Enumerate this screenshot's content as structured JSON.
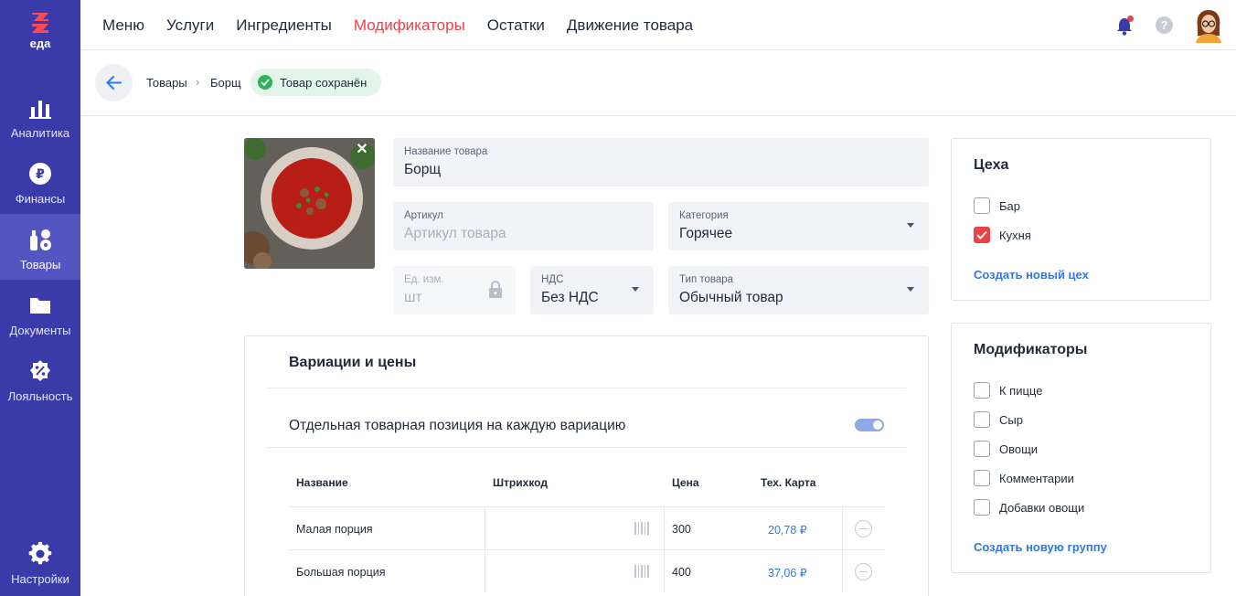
{
  "app": {
    "logo_text": "еда"
  },
  "sidebar": {
    "items": [
      {
        "label": "Аналитика",
        "icon": "chart-bars-icon"
      },
      {
        "label": "Финансы",
        "icon": "ruble-icon"
      },
      {
        "label": "Товары",
        "icon": "products-icon",
        "active": true
      },
      {
        "label": "Документы",
        "icon": "folder-icon"
      },
      {
        "label": "Лояльность",
        "icon": "discount-badge-icon"
      }
    ],
    "settings": {
      "label": "Настройки",
      "icon": "gear-icon"
    }
  },
  "topnav": {
    "items": [
      "Меню",
      "Услуги",
      "Ингредиенты",
      "Модификаторы",
      "Остатки",
      "Движение товара"
    ],
    "active": "Модификаторы"
  },
  "breadcrumb": {
    "items": [
      "Товары",
      "Борщ"
    ],
    "separator": "›",
    "saved_status": "Товар сохранён"
  },
  "product": {
    "name": {
      "label": "Название товара",
      "value": "Борщ"
    },
    "sku": {
      "label": "Артикул",
      "placeholder": "Артикул товара"
    },
    "category": {
      "label": "Категория",
      "value": "Горячее"
    },
    "unit": {
      "label": "Ед. изм.",
      "value": "шт"
    },
    "vat": {
      "label": "НДС",
      "value": "Без НДС"
    },
    "type": {
      "label": "Тип товара",
      "value": "Обычный товар"
    }
  },
  "variations": {
    "title": "Вариации и цены",
    "toggle_label": "Отдельная товарная позиция на каждую вариацию",
    "toggle_on": true,
    "columns": [
      "Название",
      "Штрихкод",
      "Цена",
      "Тех. Карта"
    ],
    "rows": [
      {
        "name": "Малая порция",
        "barcode": "",
        "price": "300",
        "tech_card": "20,78 ₽"
      },
      {
        "name": "Большая порция",
        "barcode": "",
        "price": "400",
        "tech_card": "37,06 ₽"
      }
    ]
  },
  "workshops": {
    "title": "Цеха",
    "items": [
      {
        "label": "Бар",
        "checked": false
      },
      {
        "label": "Кухня",
        "checked": true
      }
    ],
    "create_link": "Создать новый цех"
  },
  "modifiers": {
    "title": "Модификаторы",
    "items": [
      {
        "label": "К пицце",
        "checked": false
      },
      {
        "label": "Сыр",
        "checked": false
      },
      {
        "label": "Овощи",
        "checked": false
      },
      {
        "label": "Комментарии",
        "checked": false
      },
      {
        "label": "Добавки овощи",
        "checked": false
      }
    ],
    "create_link": "Создать новую группу"
  },
  "colors": {
    "sidebar": "#3a3aa8",
    "sidebar_active": "#5555c2",
    "accent_red": "#e9424b",
    "link_blue": "#3378e0",
    "success_green": "#2eb35a"
  }
}
